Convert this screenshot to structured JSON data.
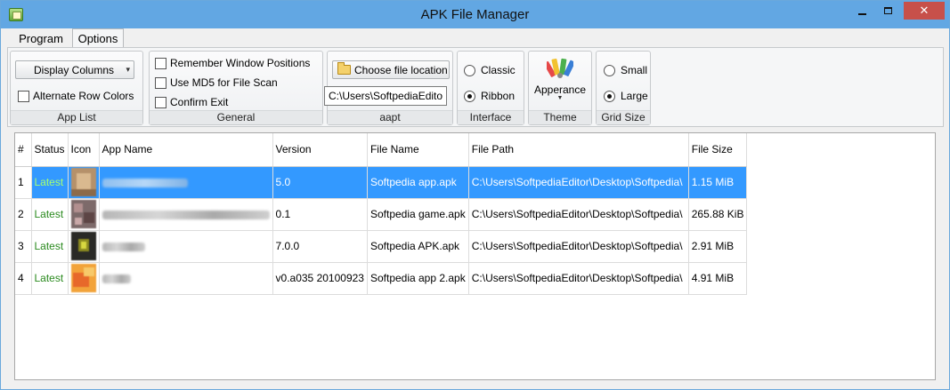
{
  "window": {
    "title": "APK File Manager"
  },
  "tabs": [
    {
      "label": "Program"
    },
    {
      "label": "Options"
    }
  ],
  "ribbon": {
    "app_list": {
      "label": "App List",
      "display_columns": "Display Columns",
      "alternate_row_colors": "Alternate Row Colors"
    },
    "general": {
      "label": "General",
      "remember_window_positions": "Remember Window Positions",
      "use_md5": "Use MD5 for File Scan",
      "confirm_exit": "Confirm Exit"
    },
    "aapt": {
      "label": "aapt",
      "choose_file_location": "Choose file location",
      "path_value": "C:\\Users\\SoftpediaEditor"
    },
    "interface": {
      "label": "Interface",
      "classic": "Classic",
      "ribbon": "Ribbon",
      "selected": "Ribbon"
    },
    "theme": {
      "label": "Theme",
      "button": "Apperance"
    },
    "grid_size": {
      "label": "Grid Size",
      "small": "Small",
      "large": "Large",
      "selected": "Large"
    }
  },
  "grid": {
    "columns": [
      "#",
      "Status",
      "Icon",
      "App Name",
      "Version",
      "File Name",
      "File Path",
      "File Size"
    ],
    "rows": [
      {
        "idx": "1",
        "status": "Latest",
        "version": "5.0",
        "file_name": "Softpedia app.apk",
        "file_path": "C:\\Users\\SoftpediaEditor\\Desktop\\Softpedia\\",
        "file_size": "1.15 MiB",
        "selected": true
      },
      {
        "idx": "2",
        "status": "Latest",
        "version": "0.1",
        "file_name": "Softpedia game.apk",
        "file_path": "C:\\Users\\SoftpediaEditor\\Desktop\\Softpedia\\",
        "file_size": "265.88 KiB",
        "selected": false
      },
      {
        "idx": "3",
        "status": "Latest",
        "version": "7.0.0",
        "file_name": "Softpedia APK.apk",
        "file_path": "C:\\Users\\SoftpediaEditor\\Desktop\\Softpedia\\",
        "file_size": "2.91 MiB",
        "selected": false
      },
      {
        "idx": "4",
        "status": "Latest",
        "version": "v0.a035 20100923",
        "file_name": "Softpedia app 2.apk",
        "file_path": "C:\\Users\\SoftpediaEditor\\Desktop\\Softpedia\\",
        "file_size": "4.91 MiB",
        "selected": false
      }
    ]
  },
  "colors": {
    "titlebar": "#62a7e3",
    "selection": "#3399ff",
    "status_latest": "#2a8a1e",
    "close_button": "#c7504a"
  }
}
